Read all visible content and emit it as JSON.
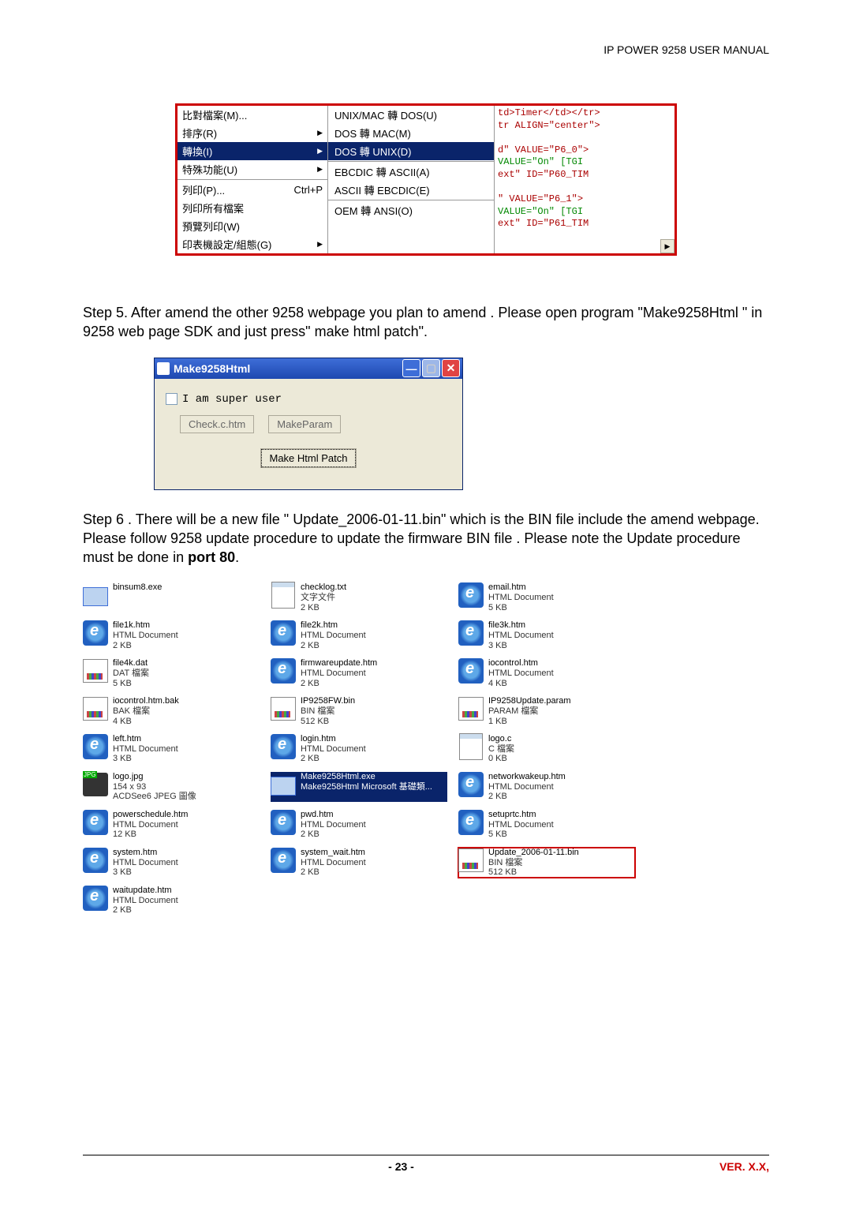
{
  "header": {
    "title": "IP POWER 9258 USER MANUAL"
  },
  "footer": {
    "page": "- 23 -",
    "version": "VER. X.X,"
  },
  "menu": {
    "left": [
      {
        "label": "比對檔案(M)..."
      },
      {
        "label": "排序(R)"
      },
      {
        "label": "轉換(I)"
      },
      {
        "label": "特殊功能(U)"
      },
      {
        "label": "列印(P)...",
        "shortcut": "Ctrl+P"
      },
      {
        "label": "列印所有檔案"
      },
      {
        "label": "預覽列印(W)"
      },
      {
        "label": "印表機設定/組態(G)"
      }
    ],
    "sub": [
      {
        "label": "UNIX/MAC 轉 DOS(U)"
      },
      {
        "label": "DOS 轉 MAC(M)"
      },
      {
        "label": "DOS 轉 UNIX(D)"
      },
      {
        "label": "EBCDIC 轉 ASCII(A)"
      },
      {
        "label": "ASCII 轉 EBCDIC(E)"
      },
      {
        "label": "OEM 轉 ANSI(O)"
      }
    ],
    "code": {
      "l1a": "td>Timer</td></tr>",
      "l1b": "tr ALIGN=\"center\">",
      "l2a": "d\" VALUE=\"P6_0\">",
      "l2b": "VALUE=\"On\" [TGI",
      "l2c": "ext\" ID=\"P60_TIM",
      "l3a": "\" VALUE=\"P6_1\">",
      "l3b": "VALUE=\"On\" [TGI",
      "l3c": "ext\" ID=\"P61_TIM"
    }
  },
  "step5": "Step 5. After amend the other 9258 webpage you plan to amend . Please open program \"Make9258Html \" in 9258 web page SDK and just press\" make html patch\".",
  "window": {
    "title": "Make9258Html",
    "checkbox_label": "I am super user",
    "btn_check": "Check.c.htm",
    "btn_make_param": "MakeParam",
    "btn_patch": "Make Html Patch"
  },
  "step6_a": "Step 6 . There will be a new file \" Update_2006-01-11.bin\" which is the BIN file include the amend webpage. Please follow  9258 update procedure to update the firmware BIN file . Please note the Update procedure must be done in ",
  "step6_b": "port 80",
  "step6_c": ".",
  "files": [
    {
      "icon": "app",
      "name": "binsum8.exe",
      "sub1": "",
      "sub2": ""
    },
    {
      "icon": "txt",
      "name": "checklog.txt",
      "sub1": "文字文件",
      "sub2": "2 KB"
    },
    {
      "icon": "ie",
      "name": "email.htm",
      "sub1": "HTML Document",
      "sub2": "5 KB"
    },
    {
      "icon": "ie",
      "name": "file1k.htm",
      "sub1": "HTML Document",
      "sub2": "2 KB"
    },
    {
      "icon": "ie",
      "name": "file2k.htm",
      "sub1": "HTML Document",
      "sub2": "2 KB"
    },
    {
      "icon": "ie",
      "name": "file3k.htm",
      "sub1": "HTML Document",
      "sub2": "3 KB"
    },
    {
      "icon": "bin",
      "name": "file4k.dat",
      "sub1": "DAT 檔案",
      "sub2": "5 KB"
    },
    {
      "icon": "ie",
      "name": "firmwareupdate.htm",
      "sub1": "HTML Document",
      "sub2": "2 KB"
    },
    {
      "icon": "ie",
      "name": "iocontrol.htm",
      "sub1": "HTML Document",
      "sub2": "4 KB"
    },
    {
      "icon": "bin",
      "name": "iocontrol.htm.bak",
      "sub1": "BAK 檔案",
      "sub2": "4 KB"
    },
    {
      "icon": "bin",
      "name": "IP9258FW.bin",
      "sub1": "BIN 檔案",
      "sub2": "512 KB"
    },
    {
      "icon": "bin",
      "name": "IP9258Update.param",
      "sub1": "PARAM 檔案",
      "sub2": "1 KB"
    },
    {
      "icon": "ie",
      "name": "left.htm",
      "sub1": "HTML Document",
      "sub2": "3 KB"
    },
    {
      "icon": "ie",
      "name": "login.htm",
      "sub1": "HTML Document",
      "sub2": "2 KB"
    },
    {
      "icon": "txt",
      "name": "logo.c",
      "sub1": "C 檔案",
      "sub2": "0 KB"
    },
    {
      "icon": "jpg",
      "name": "logo.jpg",
      "sub1": "154 x 93",
      "sub2": "ACDSee6 JPEG 圖像"
    },
    {
      "icon": "app",
      "name": "Make9258Html.exe",
      "sub1": "Make9258Html Microsoft 基礎類...",
      "sub2": "",
      "sel": true
    },
    {
      "icon": "ie",
      "name": "networkwakeup.htm",
      "sub1": "HTML Document",
      "sub2": "2 KB"
    },
    {
      "icon": "ie",
      "name": "powerschedule.htm",
      "sub1": "HTML Document",
      "sub2": "12 KB"
    },
    {
      "icon": "ie",
      "name": "pwd.htm",
      "sub1": "HTML Document",
      "sub2": "2 KB"
    },
    {
      "icon": "ie",
      "name": "setuprtc.htm",
      "sub1": "HTML Document",
      "sub2": "5 KB"
    },
    {
      "icon": "ie",
      "name": "system.htm",
      "sub1": "HTML Document",
      "sub2": "3 KB"
    },
    {
      "icon": "ie",
      "name": "system_wait.htm",
      "sub1": "HTML Document",
      "sub2": "2 KB"
    },
    {
      "icon": "bin",
      "name": "Update_2006-01-11.bin",
      "sub1": "BIN 檔案",
      "sub2": "512 KB",
      "boxed": true
    },
    {
      "icon": "ie",
      "name": "waitupdate.htm",
      "sub1": "HTML Document",
      "sub2": "2 KB"
    }
  ]
}
